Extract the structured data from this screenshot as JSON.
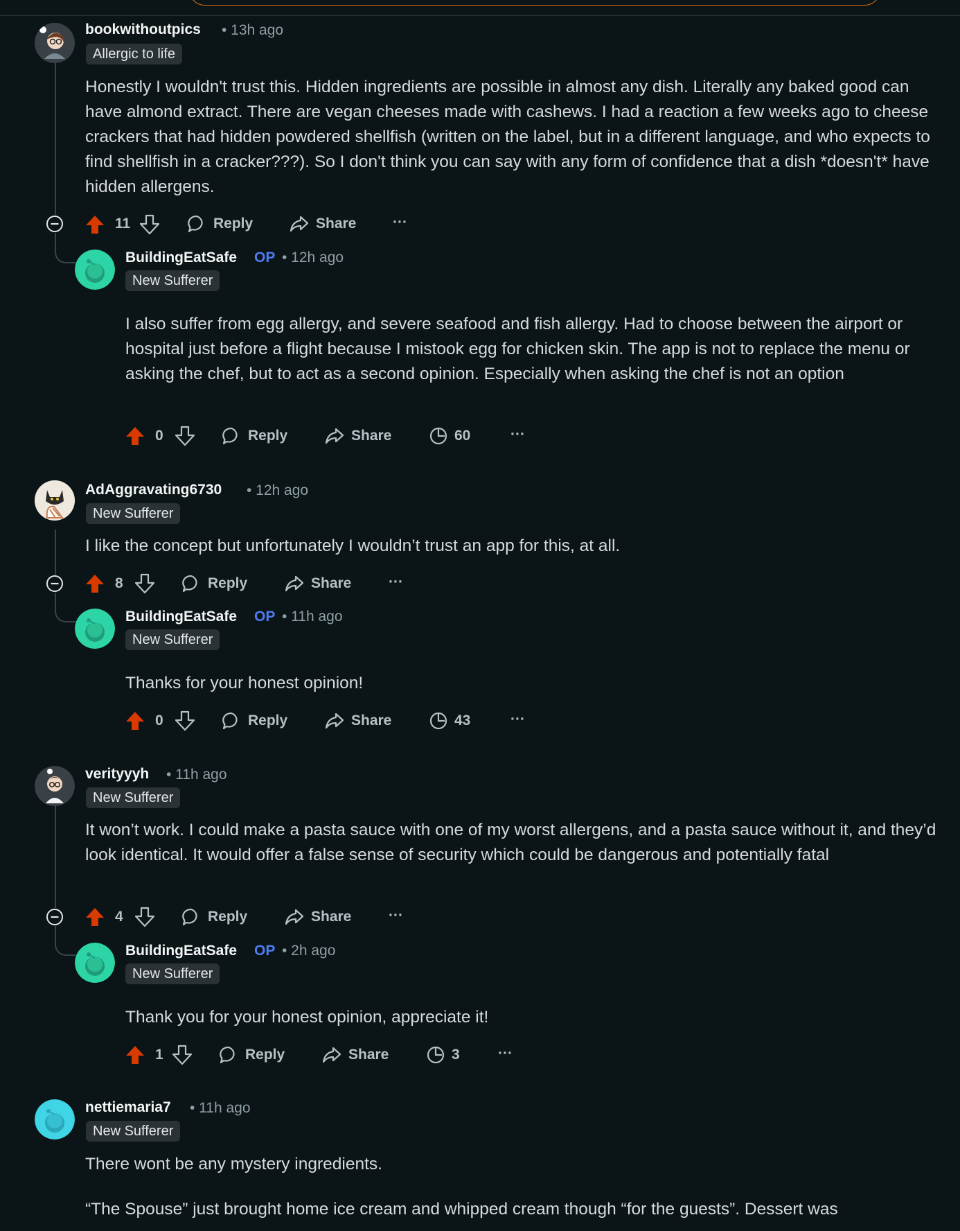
{
  "colors": {
    "background": "#0b1416",
    "upvote": "#d93a00",
    "op": "#4d7bf0",
    "muted": "#8fa0a7",
    "thread": "#39444a"
  },
  "icons": {
    "upvote": "arrow-up-filled-icon",
    "downvote": "arrow-down-icon",
    "reply": "speech-bubble-icon",
    "share": "share-arrow-icon",
    "views": "clock-icon",
    "more": "ellipsis-icon",
    "collapse": "minus-circle-icon"
  },
  "labels": {
    "reply": "Reply",
    "share": "Share",
    "more": "···",
    "op": "OP"
  },
  "comments": [
    {
      "user": "bookwithoutpics",
      "time": "• 13h ago",
      "flair": "Allergic to life",
      "body": "Honestly I wouldn't trust this. Hidden ingredients are possible in almost any dish. Literally any baked good can have almond extract. There are vegan cheeses made with cashews. I had a reaction a few weeks ago to cheese crackers that had hidden powdered shellfish (written on the label, but in a different language, and who expects to find shellfish in a cracker???). So I don't think you can say with any form of confidence that a dish *doesn't* have hidden allergens.",
      "votes": "11",
      "reply": {
        "user": "BuildingEatSafe",
        "time": "• 12h ago",
        "flair": "New Sufferer",
        "body": "I also suffer from egg allergy, and severe seafood and fish allergy. Had to choose between the airport or hospital just before a flight because I mistook egg for chicken skin. The app is not to replace the menu or asking the chef, but to act as a second opinion. Especially when asking the chef is not an option",
        "votes": "0",
        "views": "60"
      }
    },
    {
      "user": "AdAggravating6730",
      "time": "• 12h ago",
      "flair": "New Sufferer",
      "body": "I like the concept but unfortunately I wouldn’t trust an app for this, at all.",
      "votes": "8",
      "reply": {
        "user": "BuildingEatSafe",
        "time": "• 11h ago",
        "flair": "New Sufferer",
        "body": "Thanks for your honest opinion!",
        "votes": "0",
        "views": "43"
      }
    },
    {
      "user": "verityyyh",
      "time": "• 11h ago",
      "flair": "New Sufferer",
      "body": "It won’t work. I could make a pasta sauce with one of my worst allergens, and a pasta sauce without it, and they’d look identical. It would offer a false sense of security which could be dangerous and potentially fatal",
      "votes": "4",
      "reply": {
        "user": "BuildingEatSafe",
        "time": "• 2h ago",
        "flair": "New Sufferer",
        "body": "Thank you for your honest opinion, appreciate it!",
        "votes": "1",
        "views": "3"
      }
    },
    {
      "user": "nettiemaria7",
      "time": "• 11h ago",
      "flair": "New Sufferer",
      "body": "There wont be any mystery ingredients.",
      "body2": "“The Spouse” just brought home ice cream and whipped cream though “for the guests”. Dessert was"
    }
  ]
}
